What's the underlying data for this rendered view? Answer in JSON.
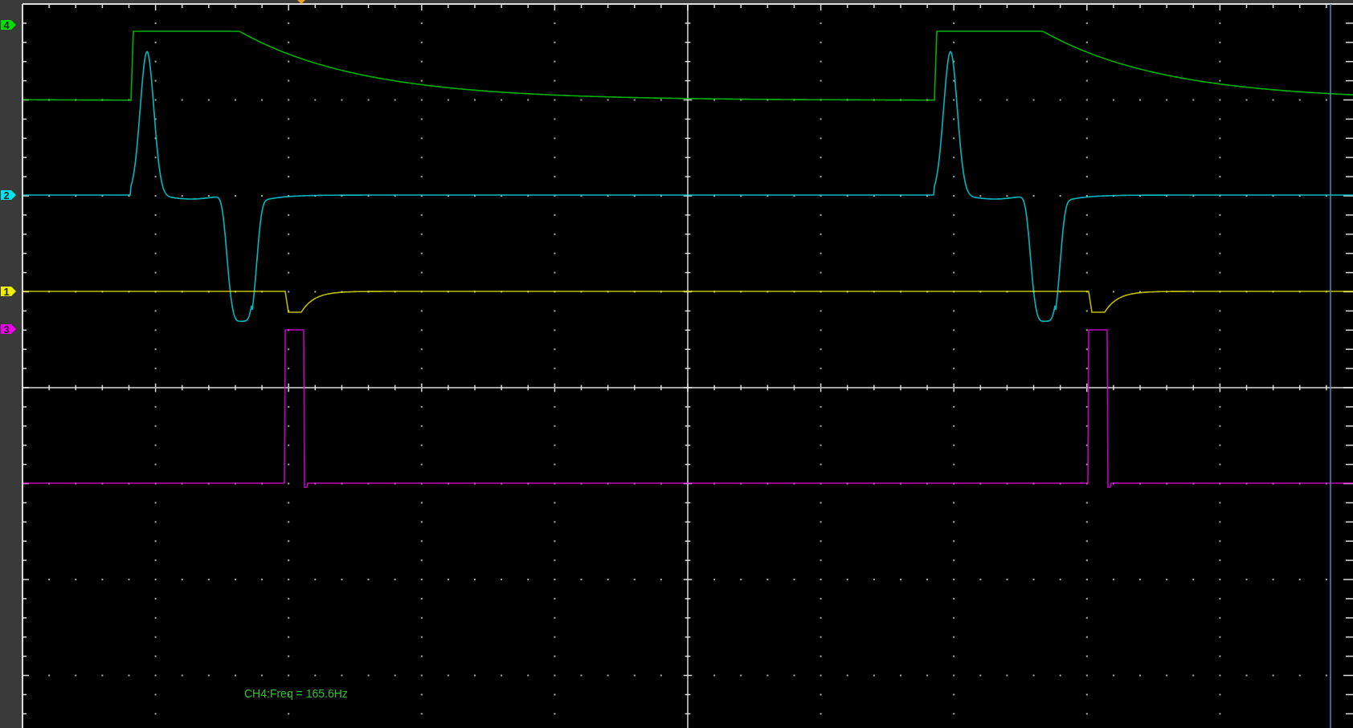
{
  "channels": [
    {
      "label": "4",
      "color": "#00dd00",
      "kind": "ramp"
    },
    {
      "label": "2",
      "color": "#00e5ee",
      "kind": "bipolar"
    },
    {
      "label": "1",
      "color": "#eeee00",
      "kind": "dip"
    },
    {
      "label": "3",
      "color": "#ee00ee",
      "kind": "pulse"
    }
  ],
  "measurement": "CH4:Freq = 165.6Hz"
}
